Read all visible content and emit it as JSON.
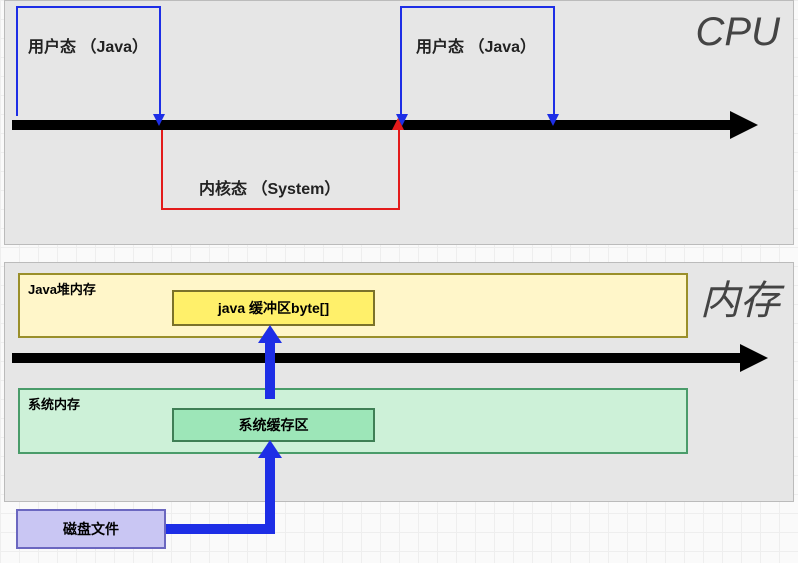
{
  "cpu": {
    "title": "CPU",
    "user_mode_1": "用户态 （Java）",
    "user_mode_2": "用户态 （Java）",
    "kernel_mode": "内核态 （System）"
  },
  "memory": {
    "title": "内存",
    "heap": {
      "label": "Java堆内存",
      "buffer": "java 缓冲区byte[]"
    },
    "system": {
      "label": "系统内存",
      "cache": "系统缓存区"
    },
    "disk": "磁盘文件"
  }
}
